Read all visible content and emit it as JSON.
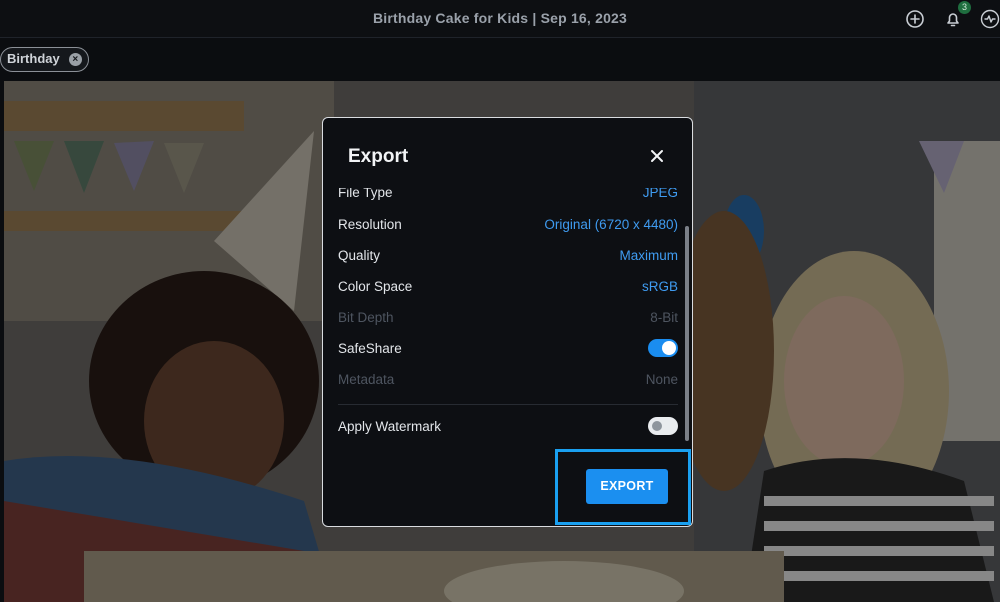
{
  "header": {
    "title": "Birthday Cake for Kids | Sep 16, 2023",
    "icons": [
      "add-icon",
      "bell-icon",
      "activity-icon"
    ],
    "notification_count": "3"
  },
  "tags": [
    {
      "label": "Birthday"
    }
  ],
  "modal": {
    "title": "Export",
    "rows": [
      {
        "label": "File Type",
        "value": "JPEG",
        "enabled": true
      },
      {
        "label": "Resolution",
        "value": "Original (6720 x 4480)",
        "enabled": true
      },
      {
        "label": "Quality",
        "value": "Maximum",
        "enabled": true
      },
      {
        "label": "Color Space",
        "value": "sRGB",
        "enabled": true
      },
      {
        "label": "Bit Depth",
        "value": "8-Bit",
        "enabled": false
      },
      {
        "label": "SafeShare",
        "toggle": true,
        "enabled": true
      },
      {
        "label": "Metadata",
        "value": "None",
        "enabled": false
      },
      {
        "label": "Apply Watermark",
        "toggle": false,
        "enabled": true
      }
    ],
    "export_label": "EXPORT"
  },
  "colors": {
    "accent": "#1b8ff0",
    "link": "#3f9bf0",
    "highlight": "#1aa0f0"
  }
}
